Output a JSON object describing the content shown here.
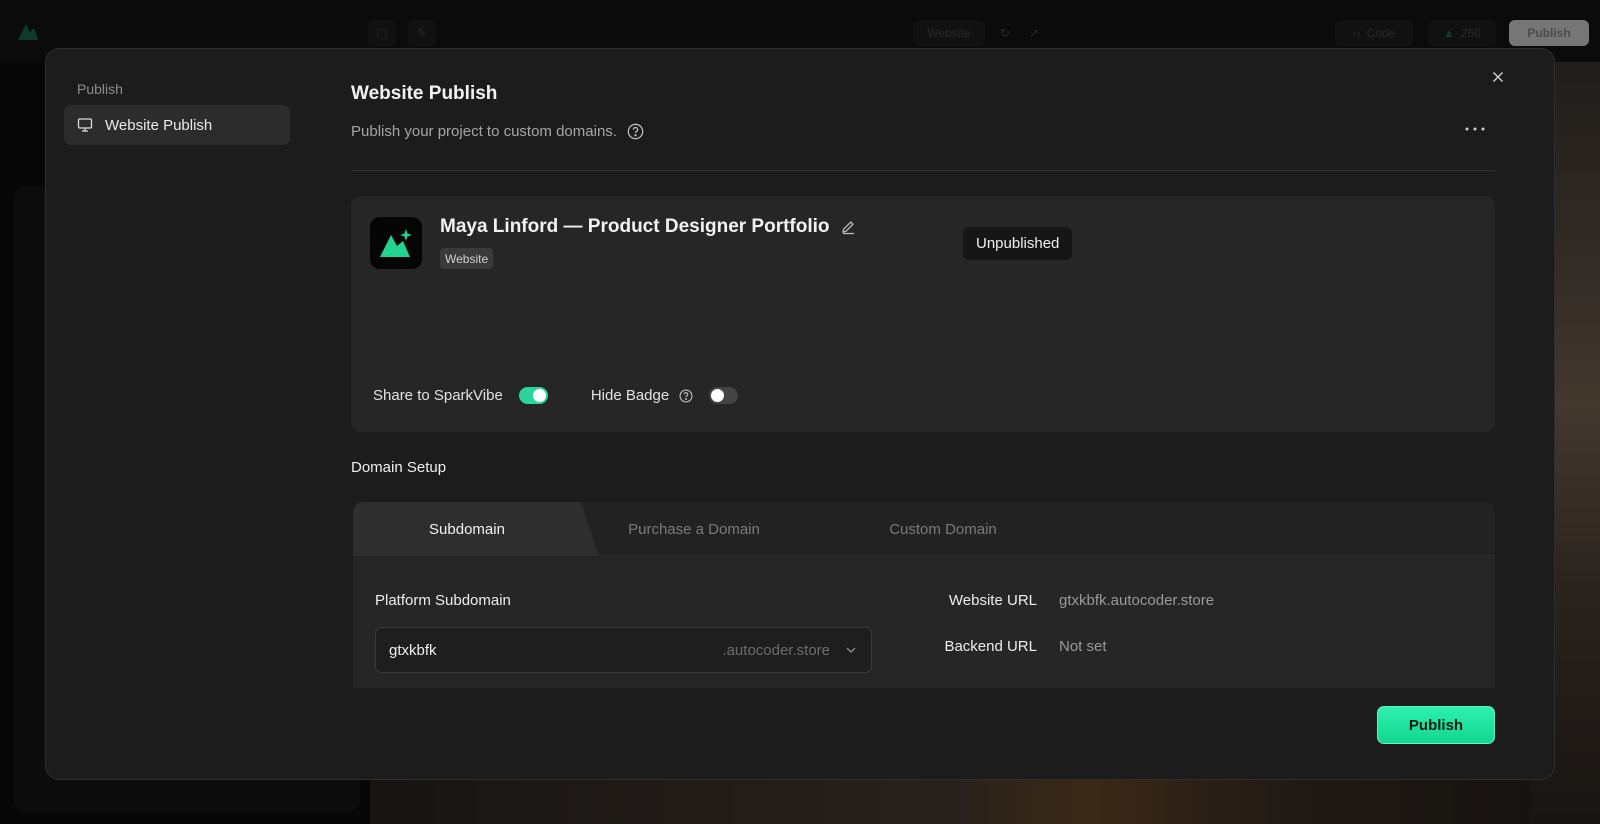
{
  "background": {
    "topbar_center_label": "Website",
    "code_label": "Code",
    "credits": "260",
    "publish_label": "Publish"
  },
  "sidebar": {
    "heading": "Publish",
    "items": [
      {
        "label": "Website Publish",
        "icon": "monitor-icon"
      }
    ]
  },
  "header": {
    "title": "Website Publish",
    "description": "Publish your project to custom domains."
  },
  "project": {
    "name": "Maya Linford — Product Designer Portfolio",
    "type": "Website",
    "status": "Unpublished",
    "share_label": "Share to SparkVibe",
    "share_enabled": true,
    "hide_badge_label": "Hide Badge",
    "hide_badge_enabled": false
  },
  "domain_setup": {
    "title": "Domain Setup",
    "tabs": [
      {
        "label": "Subdomain",
        "active": true
      },
      {
        "label": "Purchase a Domain",
        "active": false
      },
      {
        "label": "Custom Domain",
        "active": false
      }
    ],
    "platform_subdomain_label": "Platform Subdomain",
    "subdomain_value": "gtxkbfk",
    "subdomain_suffix": ".autocoder.store",
    "website_url_label": "Website URL",
    "website_url_value": "gtxkbfk.autocoder.store",
    "backend_url_label": "Backend URL",
    "backend_url_value": "Not set"
  },
  "footer": {
    "publish_label": "Publish"
  },
  "colors": {
    "accent": "#14d690",
    "modal_bg": "#1c1c1c",
    "card_bg": "#262626"
  }
}
